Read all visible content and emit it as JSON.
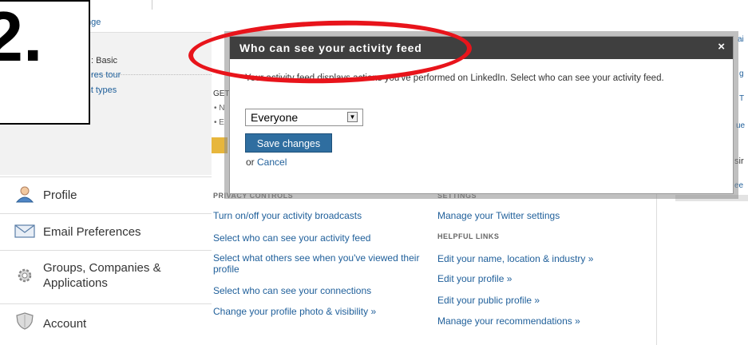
{
  "step_label": "2.",
  "left_summary": {
    "change_link": "nge",
    "account_type": ": Basic",
    "features_tour_link": "res tour",
    "compare_link": "ompare account types"
  },
  "nav": [
    {
      "label": "Profile",
      "icon": "profile-icon"
    },
    {
      "label": "Email Preferences",
      "icon": "envelope-icon"
    },
    {
      "label": "Groups, Companies & Applications",
      "icon": "gear-icon"
    },
    {
      "label": "Account",
      "icon": "shield-icon"
    }
  ],
  "background_hint": {
    "get": "GET",
    "bullet1": "• N",
    "bullet2": "• E"
  },
  "modal": {
    "title": "Who can see your activity feed",
    "close": "×",
    "description": "Your activity feed displays actions you've performed on LinkedIn. Select who can see your activity feed.",
    "select_value": "Everyone",
    "save_label": "Save changes",
    "or_text": "or",
    "cancel_label": "Cancel"
  },
  "privacy_controls": {
    "heading": "PRIVACY CONTROLS",
    "links": [
      "Turn on/off your activity broadcasts",
      "Select who can see your activity feed",
      "Select what others see when you've viewed their profile",
      "Select who can see your connections",
      "Change your profile photo & visibility »"
    ]
  },
  "settings": {
    "heading": "SETTINGS",
    "twitter_link": "Manage your Twitter settings",
    "helpful_heading": "HELPFUL LINKS",
    "helpful_links": [
      "Edit your name, location & industry »",
      "Edit your profile »",
      "Edit your public profile »",
      "Manage your recommendations »"
    ]
  },
  "right_edge": {
    "a": "ai",
    "b": "g",
    "c": "T",
    "d": "ue",
    "e": "sir",
    "f": "ee"
  },
  "colors": {
    "accent_link": "#1f5f9a",
    "modal_header": "#3f3f3f",
    "save_button": "#2f6ea0",
    "annotation": "#e8141b"
  }
}
